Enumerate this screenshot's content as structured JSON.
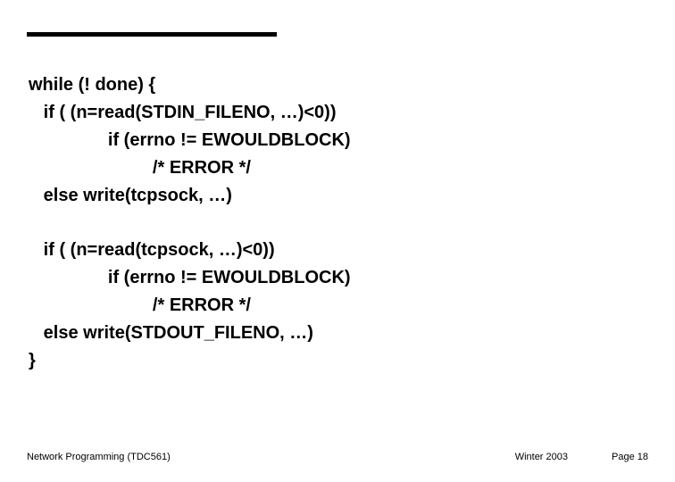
{
  "code": {
    "l1": "while (! done) {",
    "l2": "   if ( (n=read(STDIN_FILENO, …)<0))",
    "l3": "                if (errno != EWOULDBLOCK)",
    "l4": "                         /* ERROR */",
    "l5": "   else write(tcpsock, …)",
    "l6": "   if ( (n=read(tcpsock, …)<0))",
    "l7": "                if (errno != EWOULDBLOCK)",
    "l8": "                         /* ERROR */",
    "l9": "   else write(STDOUT_FILENO, …)",
    "l10": "}"
  },
  "footer": {
    "left": "Network Programming (TDC561)",
    "mid": "Winter 2003",
    "right": "Page 18"
  }
}
